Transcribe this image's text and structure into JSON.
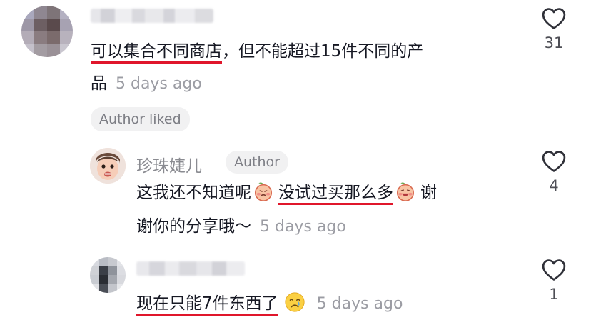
{
  "comments": [
    {
      "text_underlined": "可以集合不同商店",
      "text_line1_rest": "，但不能超过15件不同的产",
      "text_line2": "品",
      "time": "5 days ago",
      "badge": "Author liked",
      "likes": "31"
    },
    {
      "author": "珍珠婕儿",
      "author_tag": "Author",
      "text_part1": "这我还不知道呢",
      "text_underlined": "没试过买那么多",
      "text_part2": "谢",
      "text_line2": "谢你的分享哦～",
      "time": "5 days ago",
      "likes": "4"
    },
    {
      "text_underlined": "现在只能7件东西了",
      "time": "5 days ago",
      "likes": "1"
    }
  ],
  "icons": {
    "like": "heart-outline-icon",
    "emoji_peach": "peach-face-icon",
    "emoji_cry": "crying-face-icon"
  },
  "colors": {
    "underline": "#e0162b",
    "secondary_text": "#9b9ca3",
    "pill_bg": "#f1f1f2"
  }
}
